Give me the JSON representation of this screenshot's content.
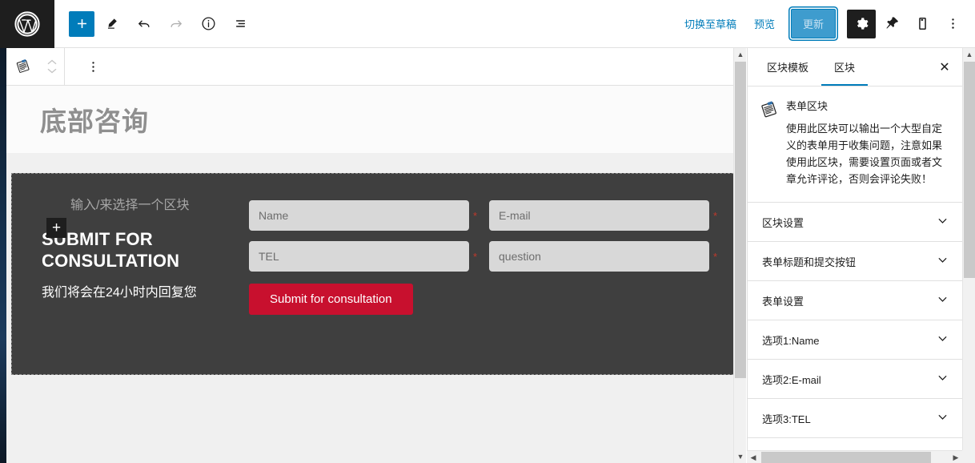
{
  "topbar": {
    "logo_icon": "wordpress-logo-icon",
    "left_tools": [
      {
        "name": "add-block-button",
        "icon": "plus-icon",
        "label": "+"
      },
      {
        "name": "edit-tool-button",
        "icon": "pencil-icon",
        "label": ""
      },
      {
        "name": "undo-button",
        "icon": "undo-arrow-icon",
        "label": ""
      },
      {
        "name": "redo-button",
        "icon": "redo-arrow-icon",
        "label": ""
      },
      {
        "name": "details-button",
        "icon": "info-circle-icon",
        "label": ""
      },
      {
        "name": "list-view-button",
        "icon": "list-view-icon",
        "label": ""
      }
    ],
    "switch_to_draft": "切换至草稿",
    "preview": "预览",
    "update": "更新",
    "settings_icon": "gear-icon",
    "plugin_icon": "pin-icon",
    "mobile_icon": "mobile-device-icon",
    "more_icon": "three-dots-vertical-icon"
  },
  "block_toolbar": {
    "block_icon": "form-block-icon",
    "move_up_icon": "chevron-up-icon",
    "move_down_icon": "chevron-down-icon",
    "options_icon": "three-dots-vertical-icon"
  },
  "canvas": {
    "post_title": "底部咨询",
    "form": {
      "block_placeholder": "输入/来选择一个区块",
      "inserter_label": "+",
      "heading": "SUBMIT FOR CONSULTATION",
      "subheading": "我们将会在24小时内回复您",
      "fields": [
        {
          "name": "name-field",
          "placeholder": "Name",
          "required_mark": "*"
        },
        {
          "name": "email-field",
          "placeholder": "E-mail",
          "required_mark": "*"
        },
        {
          "name": "tel-field",
          "placeholder": "TEL",
          "required_mark": "*"
        },
        {
          "name": "question-field",
          "placeholder": "question",
          "required_mark": "*"
        }
      ],
      "submit_label": "Submit for consultation",
      "submit_color": "#c8102e",
      "block_bg": "#3f3f3f"
    }
  },
  "sidebar": {
    "tabs": [
      {
        "label": "区块模板",
        "active": false
      },
      {
        "label": "区块",
        "active": true
      }
    ],
    "close_label": "✕",
    "block_info": {
      "icon": "form-block-icon",
      "title": "表单区块",
      "description": "使用此区块可以输出一个大型自定义的表单用于收集问题，注意如果使用此区块，需要设置页面或者文章允许评论，否则会评论失败！"
    },
    "panels": [
      {
        "label": "区块设置",
        "chevron": "chevron-down-icon"
      },
      {
        "label": "表单标题和提交按钮",
        "chevron": "chevron-down-icon"
      },
      {
        "label": "表单设置",
        "chevron": "chevron-down-icon"
      },
      {
        "label": "选项1:Name",
        "chevron": "chevron-down-icon"
      },
      {
        "label": "选项2:E-mail",
        "chevron": "chevron-down-icon"
      },
      {
        "label": "选项3:TEL",
        "chevron": "chevron-down-icon"
      }
    ]
  },
  "scrollbars": {
    "up_arrow": "▲",
    "down_arrow": "▼",
    "left_arrow": "◀",
    "right_arrow": "▶"
  },
  "colors": {
    "accent_blue": "#007cba",
    "admin_dark": "#1e1e1e",
    "crimson": "#c8102e"
  }
}
